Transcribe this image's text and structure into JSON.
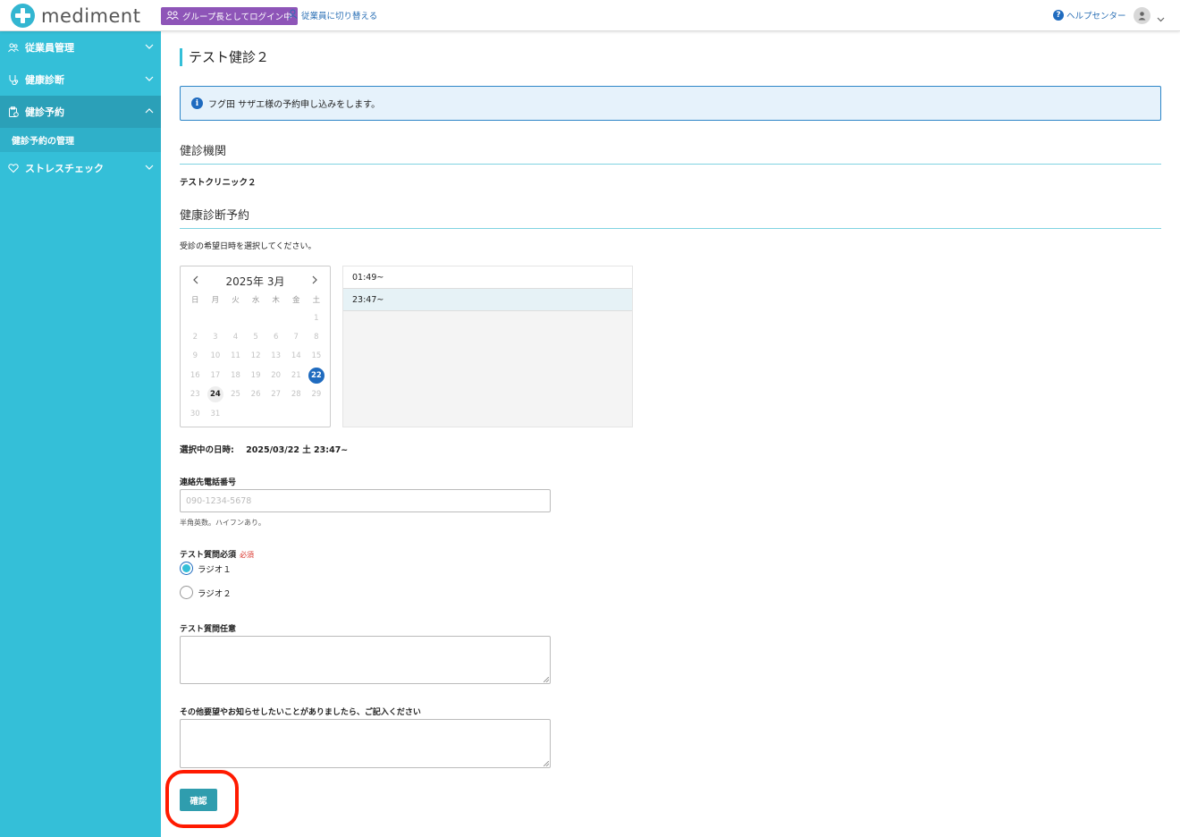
{
  "header": {
    "logo_text": "mediment",
    "group_badge": "グループ長としてログイン中",
    "switch_link": "従業員に切り替える",
    "help_link": "ヘルプセンター"
  },
  "sidebar": {
    "items": [
      {
        "label": "従業員管理",
        "icon": "people-icon"
      },
      {
        "label": "健康診断",
        "icon": "stethoscope-icon"
      },
      {
        "label": "健診予約",
        "icon": "clipboard-icon"
      },
      {
        "label": "ストレスチェック",
        "icon": "heart-icon"
      }
    ],
    "sub_item": "健診予約の管理"
  },
  "main": {
    "title": "テスト健診２",
    "info": "フグ田 サザエ様の予約申し込みをします。",
    "section_clinic": "健診機関",
    "clinic_name": "テストクリニック２",
    "section_booking": "健康診断予約",
    "instruction": "受診の希望日時を選択してください。",
    "calendar": {
      "month_label": "2025年 3月",
      "weekdays": [
        "日",
        "月",
        "火",
        "水",
        "木",
        "金",
        "土"
      ],
      "days": [
        "",
        "",
        "",
        "",
        "",
        "",
        "1",
        "2",
        "3",
        "4",
        "5",
        "6",
        "7",
        "8",
        "9",
        "10",
        "11",
        "12",
        "13",
        "14",
        "15",
        "16",
        "17",
        "18",
        "19",
        "20",
        "21",
        "22",
        "23",
        "24",
        "25",
        "26",
        "27",
        "28",
        "29",
        "30",
        "31",
        "",
        "",
        "",
        "",
        ""
      ],
      "selected_day": "22",
      "today": "24"
    },
    "time_slots": [
      "01:49~",
      "23:47~"
    ],
    "selected_slot": "23:47~",
    "selected_label": "選択中の日時:",
    "selected_value": "2025/03/22 土 23:47~",
    "phone": {
      "label": "連絡先電話番号",
      "placeholder": "090-1234-5678",
      "hint": "半角英数。ハイフンあり。"
    },
    "q_required": {
      "label": "テスト質問必須",
      "required_mark": "必須",
      "options": [
        "ラジオ１",
        "ラジオ２"
      ],
      "selected": "ラジオ１"
    },
    "q_optional": {
      "label": "テスト質問任意"
    },
    "other": {
      "label": "その他要望やお知らせしたいことがありましたら、ご記入ください"
    },
    "confirm_button": "確認"
  },
  "colors": {
    "sidebar": "#34bfd8",
    "sidebar_active": "#2ba0b8",
    "accent_blue": "#1f6bbf",
    "button": "#2f9dae",
    "highlight": "#ff1a00"
  }
}
